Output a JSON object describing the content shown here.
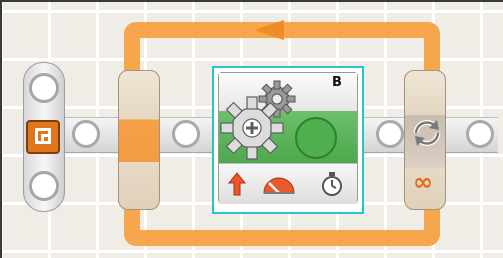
{
  "program": {
    "motor_block": {
      "port_label": "B",
      "icons": [
        "gear-icon",
        "gear-icon",
        "green-circle-icon",
        "direction-up-arrow-icon",
        "power-meter-icon",
        "stopwatch-icon"
      ]
    },
    "loop": {
      "count_label": "∞",
      "icons": [
        "loop-cycle-icon",
        "infinity-icon",
        "loop-arrow-icon"
      ]
    },
    "start": {
      "icon": "start-icon"
    }
  },
  "colors": {
    "loop_orange": "#f6a64c",
    "selection_cyan": "#28c3c6",
    "motor_green": "#4ea84c",
    "accent_orange": "#e0761e"
  }
}
